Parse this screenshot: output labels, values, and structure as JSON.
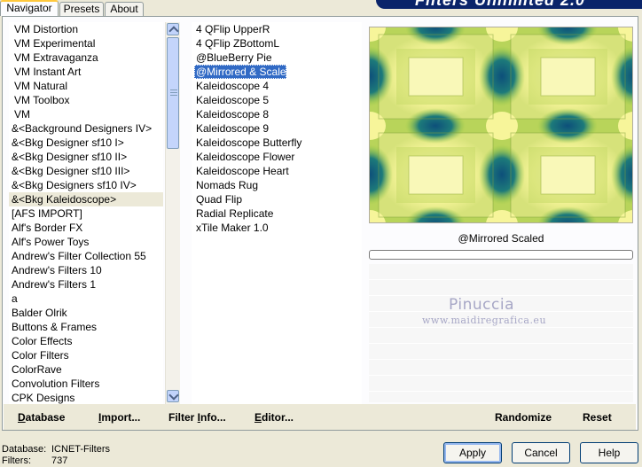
{
  "tabs": [
    "Navigator",
    "Presets",
    "About"
  ],
  "banner_title": "Filters Unlimited 2.0",
  "categories": [
    "VM Distortion",
    "VM Experimental",
    "VM Extravaganza",
    "VM Instant Art",
    "VM Natural",
    "VM Toolbox",
    "VM",
    "&<Background Designers IV>",
    "&<Bkg Designer sf10 I>",
    "&<Bkg Designer sf10 II>",
    "&<Bkg Designer sf10 III>",
    "&<Bkg Designers sf10 IV>",
    "&<Bkg Kaleidoscope>",
    "[AFS IMPORT]",
    "Alf's Border FX",
    "Alf's Power Toys",
    "Andrew's Filter Collection 55",
    "Andrew's Filters 10",
    "Andrew's Filters 1",
    "a",
    "Balder Olrik",
    "Buttons & Frames",
    "Color Effects",
    "Color Filters",
    "ColorRave",
    "Convolution Filters",
    "CPK Designs"
  ],
  "filters": [
    "4 QFlip UpperR",
    "4 QFlip ZBottomL",
    "@BlueBerry Pie",
    "@Mirrored & Scaled",
    "Kaleidoscope 4",
    "Kaleidoscope 5",
    "Kaleidoscope 8",
    "Kaleidoscope 9",
    "Kaleidoscope Butterfly",
    "Kaleidoscope Flower",
    "Kaleidoscope Heart",
    "Nomads Rug",
    "Quad Flip",
    "Radial Replicate",
    "xTile Maker 1.0"
  ],
  "selected_filter_name": "@Mirrored  Scaled",
  "watermark": {
    "name": "Pinuccia",
    "url": "www.maidiregrafica.eu"
  },
  "bottom_left": {
    "database": {
      "pre": "",
      "key": "D",
      "post": "atabase"
    },
    "import": {
      "pre": "",
      "key": "I",
      "post": "mport..."
    },
    "filter_info": {
      "pre": "Filter ",
      "key": "I",
      "post": "nfo..."
    },
    "editor": {
      "pre": "",
      "key": "E",
      "post": "ditor..."
    }
  },
  "bottom_right": {
    "randomize": "Randomize",
    "reset": "Reset"
  },
  "status": {
    "database_label": "Database:",
    "database_value": "ICNET-Filters",
    "filters_label": "Filters:",
    "filters_value": "737"
  },
  "buttons": {
    "apply": "Apply",
    "cancel": "Cancel",
    "help": "Help"
  },
  "colors": {
    "selection": "#316ac5",
    "preview_yellow": "#f7f59a",
    "preview_green": "#8dc63f",
    "preview_blue": "#0d4f7a"
  }
}
